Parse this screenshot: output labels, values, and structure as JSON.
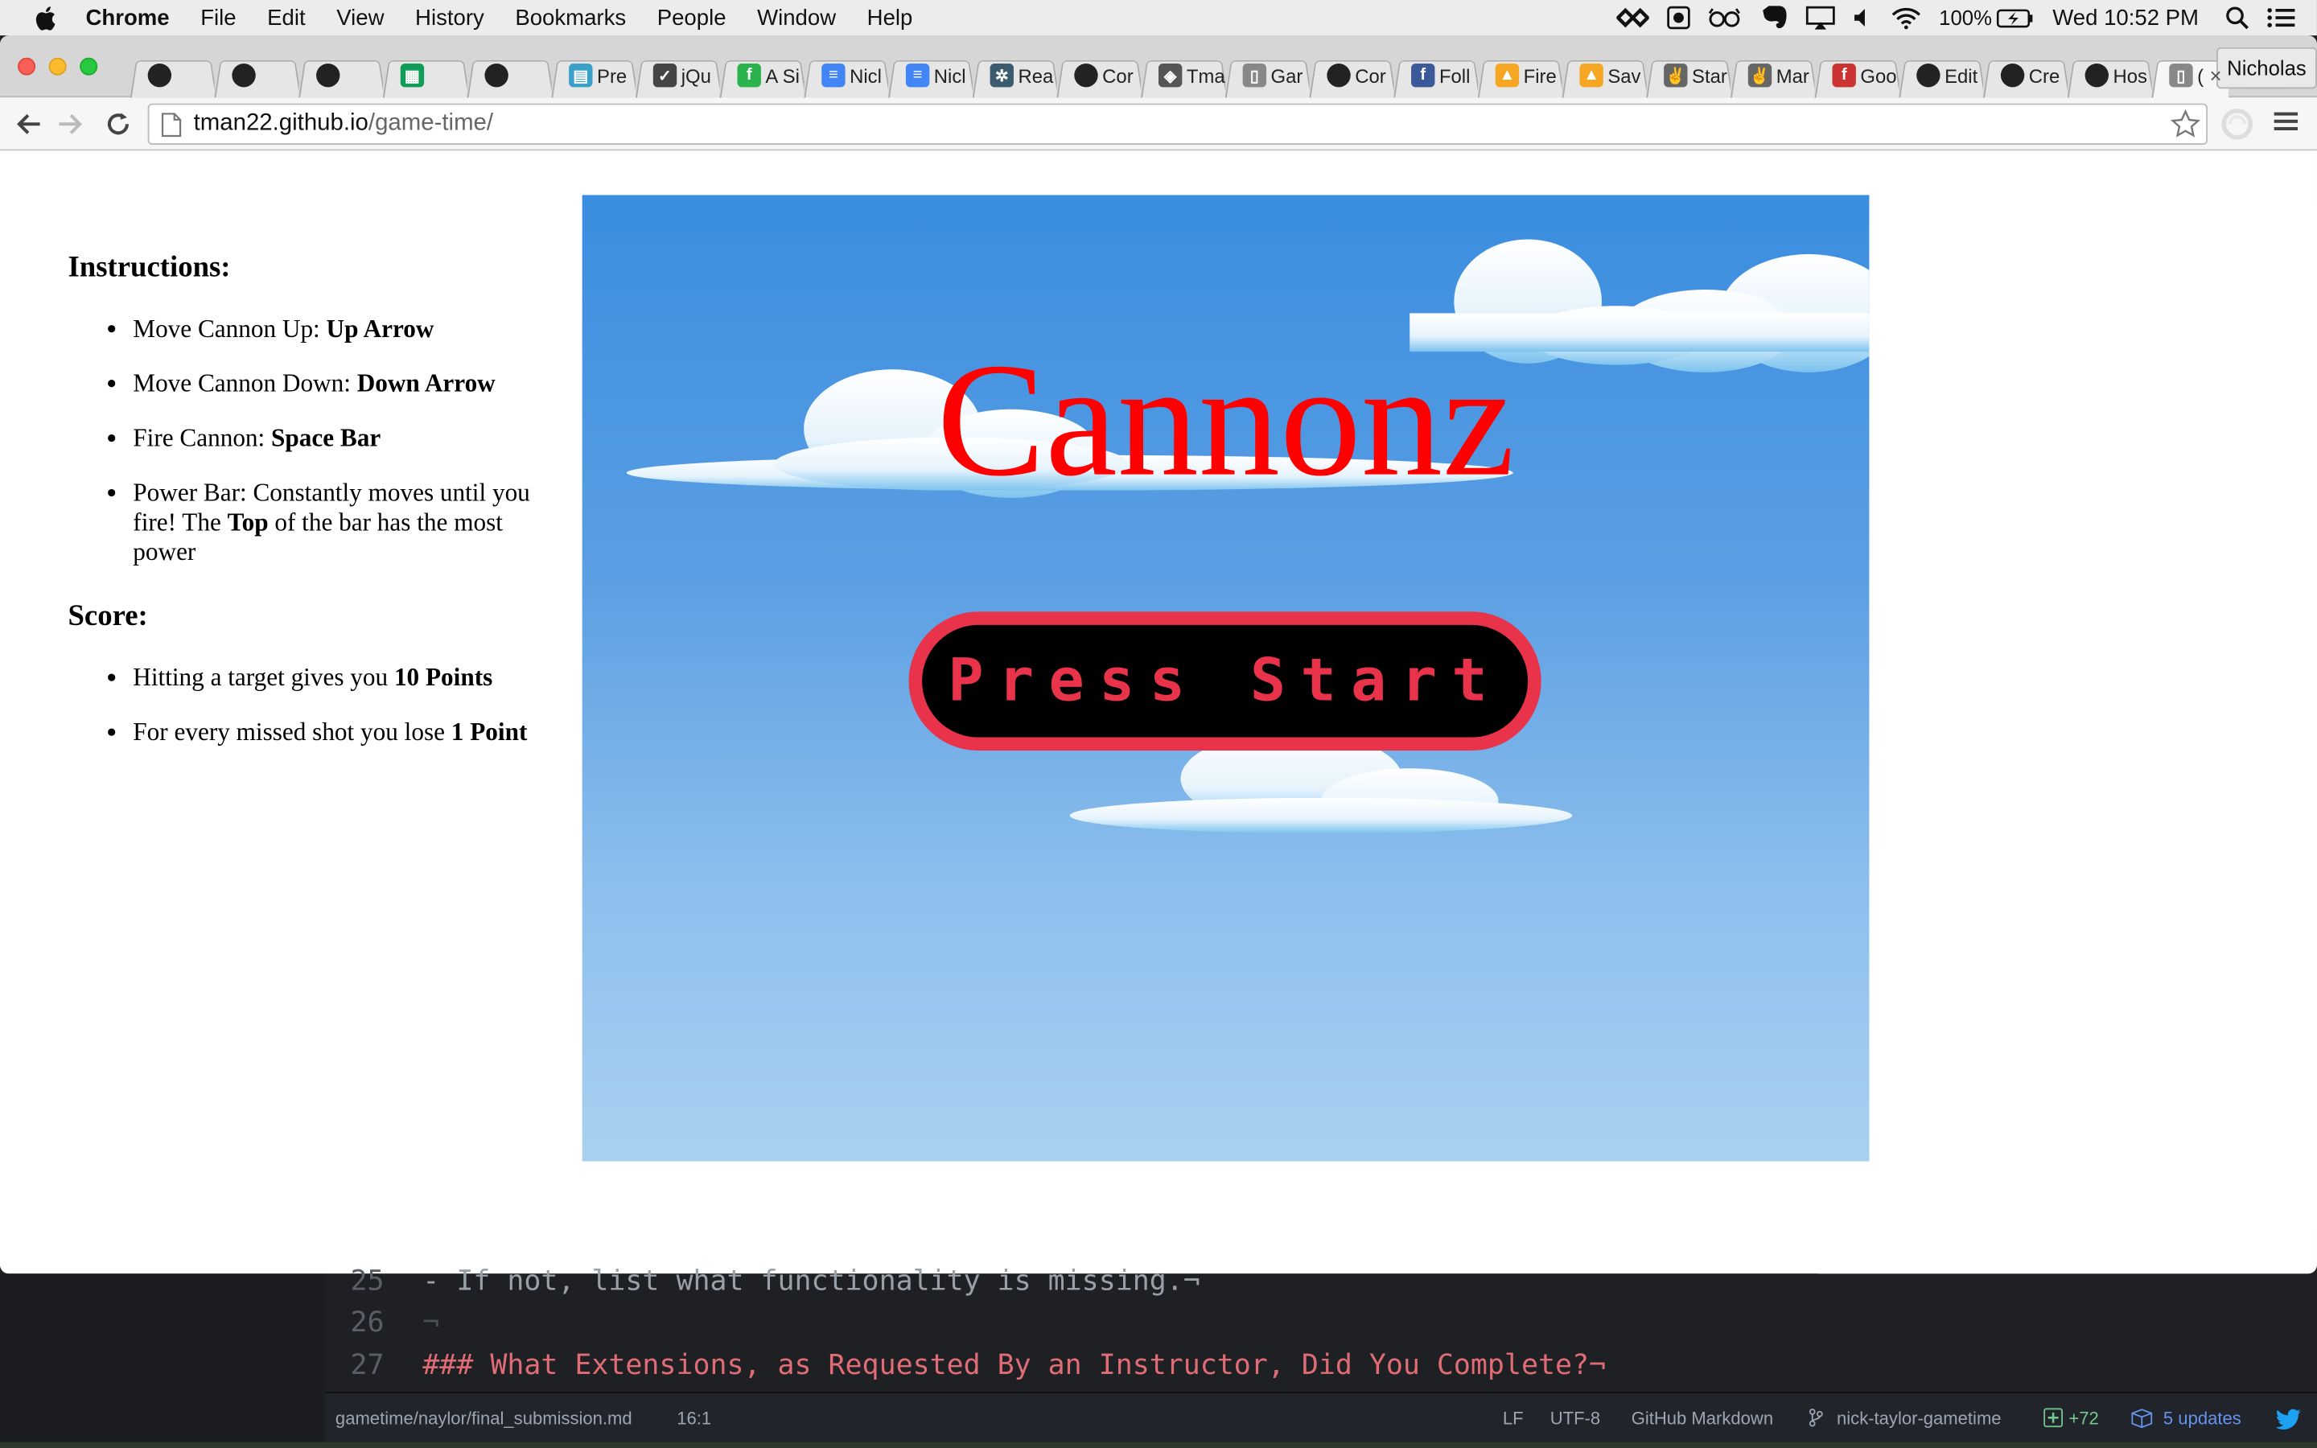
{
  "menubar": {
    "app_name": "Chrome",
    "items": [
      "File",
      "Edit",
      "View",
      "History",
      "Bookmarks",
      "People",
      "Window",
      "Help"
    ],
    "battery": "100%",
    "clock": "Wed 10:52 PM"
  },
  "browser": {
    "profile_name": "Nicholas",
    "tabs": [
      {
        "icon": "github-icon",
        "label": ""
      },
      {
        "icon": "github-icon",
        "label": ""
      },
      {
        "icon": "github-icon",
        "label": ""
      },
      {
        "icon": "sheets-icon",
        "label": ""
      },
      {
        "icon": "github-icon",
        "label": ""
      },
      {
        "icon": "preview-icon",
        "label": "Pre"
      },
      {
        "icon": "jquery-icon",
        "label": "jQu"
      },
      {
        "icon": "feedly-icon",
        "label": "A Si"
      },
      {
        "icon": "docs-icon",
        "label": "Nicl"
      },
      {
        "icon": "docs-icon",
        "label": "Nicl"
      },
      {
        "icon": "react-icon",
        "label": "Rea"
      },
      {
        "icon": "github-icon",
        "label": "Cor"
      },
      {
        "icon": "tma-icon",
        "label": "Tma"
      },
      {
        "icon": "page-icon",
        "label": "Gar"
      },
      {
        "icon": "github-icon",
        "label": "Cor"
      },
      {
        "icon": "facebook-icon",
        "label": "Foll"
      },
      {
        "icon": "firebase-icon",
        "label": "Fire"
      },
      {
        "icon": "firebase-icon",
        "label": "Sav"
      },
      {
        "icon": "peace-icon",
        "label": "Star"
      },
      {
        "icon": "peace-icon",
        "label": "Mar"
      },
      {
        "icon": "flash-icon",
        "label": "Goo"
      },
      {
        "icon": "github-icon",
        "label": "Edit"
      },
      {
        "icon": "github-icon",
        "label": "Cre"
      },
      {
        "icon": "github-icon",
        "label": "Hos"
      },
      {
        "icon": "page-icon",
        "label": "("
      }
    ],
    "url_host": "tman22.github.io",
    "url_path": "/game-time/"
  },
  "page": {
    "instructions_heading": "Instructions:",
    "instructions": [
      {
        "text": "Move Cannon Up: ",
        "bold": "Up Arrow",
        "tail": ""
      },
      {
        "text": "Move Cannon Down: ",
        "bold": "Down Arrow",
        "tail": ""
      },
      {
        "text": "Fire Cannon: ",
        "bold": "Space Bar",
        "tail": ""
      },
      {
        "text": "Power Bar: Constantly moves until you fire! The ",
        "bold": "Top",
        "tail": " of the bar has the most power"
      }
    ],
    "score_heading": "Score:",
    "score_rules": [
      {
        "text": "Hitting a target gives you ",
        "bold": "10 Points",
        "tail": ""
      },
      {
        "text": "For every missed shot you lose ",
        "bold": "1 Point",
        "tail": ""
      }
    ],
    "game_title": "Cannonz",
    "start_button": "Press Start"
  },
  "editor": {
    "lines": [
      {
        "number": "25",
        "code": "- If not, list what functionality is missing.¬"
      },
      {
        "number": "26",
        "code": "¬"
      },
      {
        "number": "27",
        "code": "### What Extensions, as Requested By an Instructor, Did You Complete?¬"
      }
    ],
    "status": {
      "file_path": "gametime/naylor/final_submission.md",
      "cursor": "16:1",
      "line_ending": "LF",
      "encoding": "UTF-8",
      "grammar": "GitHub Markdown",
      "branch": "nick-taylor-gametime",
      "diff": "+72",
      "updates": "5 updates"
    }
  },
  "colors": {
    "title_red": "#ff0000",
    "button_red": "#e8334a",
    "sky_top": "#3a8de0",
    "sky_bottom": "#a8d1f0"
  }
}
